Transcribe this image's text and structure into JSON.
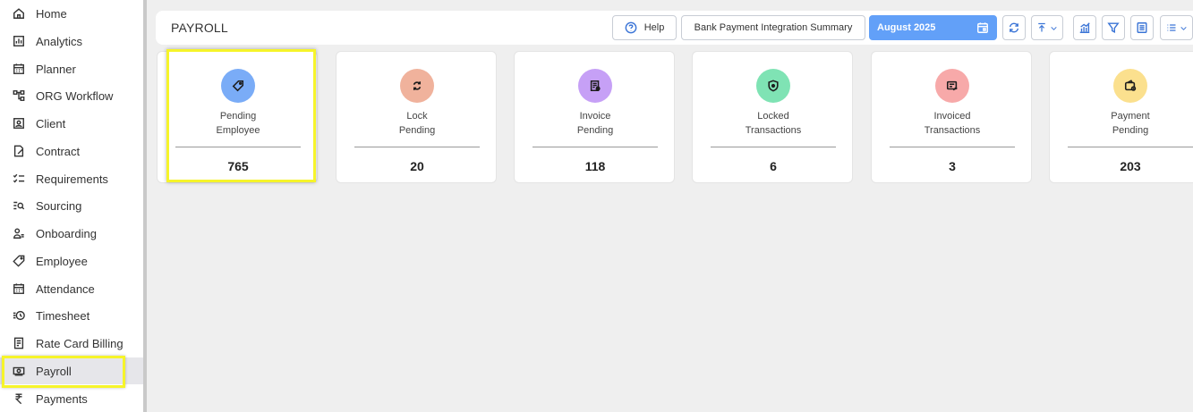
{
  "sidebar": {
    "items": [
      {
        "label": "Home",
        "icon": "home-icon"
      },
      {
        "label": "Analytics",
        "icon": "analytics-icon"
      },
      {
        "label": "Planner",
        "icon": "calendar-icon"
      },
      {
        "label": "ORG Workflow",
        "icon": "workflow-icon"
      },
      {
        "label": "Client",
        "icon": "client-icon"
      },
      {
        "label": "Contract",
        "icon": "contract-icon"
      },
      {
        "label": "Requirements",
        "icon": "checklist-icon"
      },
      {
        "label": "Sourcing",
        "icon": "sourcing-icon"
      },
      {
        "label": "Onboarding",
        "icon": "onboarding-icon"
      },
      {
        "label": "Employee",
        "icon": "employee-tag-icon"
      },
      {
        "label": "Attendance",
        "icon": "calendar-icon"
      },
      {
        "label": "Timesheet",
        "icon": "clock-list-icon"
      },
      {
        "label": "Rate Card Billing",
        "icon": "billing-icon"
      },
      {
        "label": "Payroll",
        "icon": "cash-icon"
      },
      {
        "label": "Payments",
        "icon": "rupee-icon"
      }
    ],
    "active": "Payroll"
  },
  "header": {
    "title": "PAYROLL",
    "help_label": "Help",
    "bank_label": "Bank Payment Integration Summary",
    "date_label": "August 2025"
  },
  "cards": [
    {
      "label_line1": "Pending",
      "label_line2": "Employee",
      "value": "765",
      "color": "#7aacf7",
      "icon": "tag-icon"
    },
    {
      "label_line1": "Lock",
      "label_line2": "Pending",
      "value": "20",
      "color": "#f0b29c",
      "icon": "sync-icon"
    },
    {
      "label_line1": "Invoice",
      "label_line2": "Pending",
      "value": "118",
      "color": "#c6a0f6",
      "icon": "invoice-icon"
    },
    {
      "label_line1": "Locked",
      "label_line2": "Transactions",
      "value": "6",
      "color": "#7fe3b4",
      "icon": "shield-icon"
    },
    {
      "label_line1": "Invoiced",
      "label_line2": "Transactions",
      "value": "3",
      "color": "#f7a9a9",
      "icon": "invoiced-icon"
    },
    {
      "label_line1": "Payment",
      "label_line2": "Pending",
      "value": "203",
      "color": "#fbe08e",
      "icon": "wallet-icon"
    }
  ]
}
